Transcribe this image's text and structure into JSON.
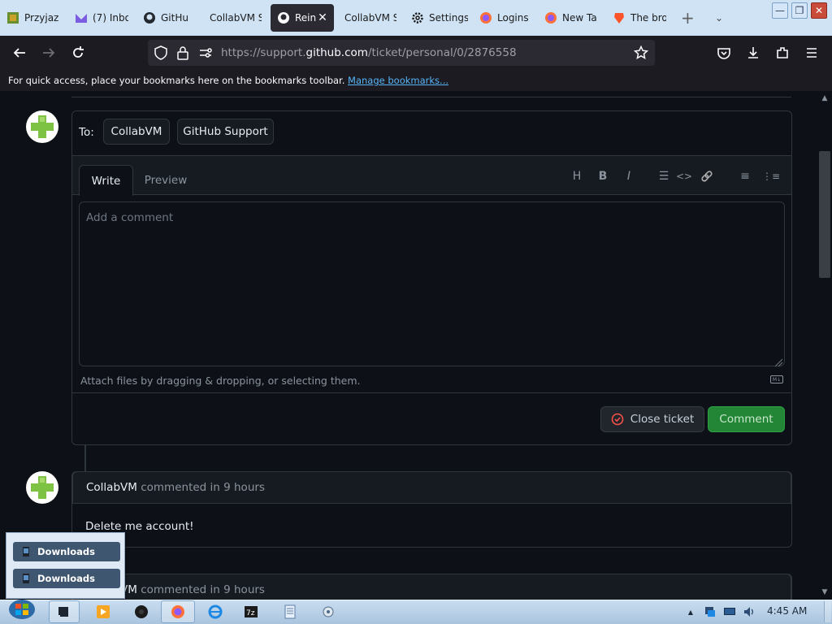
{
  "tabs": [
    {
      "label": "Przyjaz",
      "icon": "game-icon"
    },
    {
      "label": "(7) Inbo",
      "icon": "proton-mail-icon"
    },
    {
      "label": "GitHu",
      "icon": "github-icon"
    },
    {
      "label": "CollabVM S",
      "icon": "none"
    },
    {
      "label": "Rein",
      "icon": "github-icon",
      "active": true
    },
    {
      "label": "CollabVM S",
      "icon": "none"
    },
    {
      "label": "Settings",
      "icon": "gear-icon"
    },
    {
      "label": "Logins",
      "icon": "firefox-icon"
    },
    {
      "label": "New Ta",
      "icon": "firefox-icon"
    },
    {
      "label": "The bro",
      "icon": "brave-icon"
    }
  ],
  "window_controls": {
    "min": "—",
    "max": "❐",
    "close": "✕"
  },
  "address_bar": {
    "prefix": "https://support.",
    "domain": "github.com",
    "path": "/ticket/personal/0/2876558"
  },
  "bookmarks_bar": {
    "text": "For quick access, place your bookmarks here on the bookmarks toolbar.",
    "link": "Manage bookmarks..."
  },
  "reply": {
    "to_label": "To:",
    "recipients": [
      "CollabVM",
      "GitHub Support"
    ],
    "tabs": [
      "Write",
      "Preview"
    ],
    "placeholder": "Add a comment",
    "attach_hint": "Attach files by dragging & dropping, or selecting them.",
    "markdown_badge": "M↓",
    "close_ticket": "Close ticket",
    "comment": "Comment"
  },
  "toolbar": {
    "heading": "H",
    "bold": "B",
    "italic": "I",
    "quote": "☰",
    "code": "<>",
    "link": "🔗",
    "unordered": "≡",
    "ordered": "⋮≡"
  },
  "comments": [
    {
      "author": "CollabVM",
      "action": "commented in 9 hours",
      "body": "Delete me account!"
    },
    {
      "author": "CollabVM",
      "action": "commented in 9 hours",
      "body": ""
    }
  ],
  "popup": {
    "items": [
      "Downloads",
      "Downloads"
    ]
  },
  "taskbar": {
    "clock": "4:45 AM"
  }
}
